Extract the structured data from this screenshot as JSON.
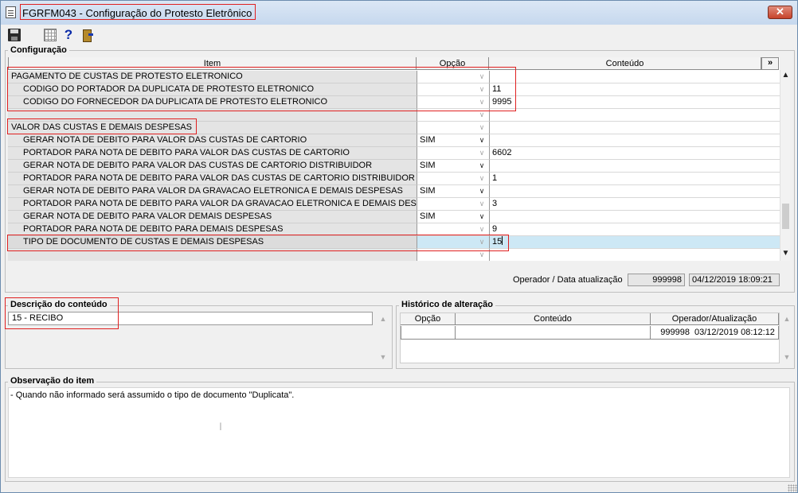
{
  "window": {
    "title": "FGRFM043 - Configuração do Protesto Eletrônico",
    "close_label": "✕"
  },
  "toolbar": {
    "icons": [
      "save-icon",
      "grid-icon",
      "help-icon",
      "exit-icon"
    ],
    "help_glyph": "?"
  },
  "config": {
    "group_label": "Configuração",
    "columns": {
      "item": "Item",
      "option": "Opção",
      "content": "Conteúdo",
      "expand": "»"
    },
    "rows": [
      {
        "item": "PAGAMENTO DE CUSTAS DE PROTESTO ELETRONICO",
        "option": "",
        "content": ""
      },
      {
        "item": "CODIGO DO PORTADOR DA DUPLICATA DE PROTESTO ELETRONICO",
        "option": "",
        "content": "11"
      },
      {
        "item": "CODIGO DO FORNECEDOR DA DUPLICATA DE PROTESTO ELETRONICO",
        "option": "",
        "content": "9995"
      },
      {
        "item": "",
        "option": "",
        "content": ""
      },
      {
        "item": "VALOR DAS CUSTAS E DEMAIS DESPESAS",
        "option": "",
        "content": ""
      },
      {
        "item": "GERAR NOTA DE DEBITO PARA VALOR DAS CUSTAS DE CARTORIO",
        "option": "SIM",
        "content": ""
      },
      {
        "item": "PORTADOR PARA NOTA DE DEBITO PARA VALOR DAS CUSTAS DE CARTORIO",
        "option": "",
        "content": "6602"
      },
      {
        "item": "GERAR NOTA DE DEBITO PARA VALOR DAS CUSTAS DE CARTORIO DISTRIBUIDOR",
        "option": "SIM",
        "content": ""
      },
      {
        "item": "PORTADOR PARA NOTA DE DEBITO PARA VALOR DAS CUSTAS DE CARTORIO DISTRIBUIDOR",
        "option": "",
        "content": "1"
      },
      {
        "item": "GERAR NOTA DE DEBITO PARA VALOR DA GRAVACAO ELETRONICA E DEMAIS DESPESAS",
        "option": "SIM",
        "content": ""
      },
      {
        "item": "PORTADOR PARA NOTA DE DEBITO PARA VALOR DA GRAVACAO ELETRONICA E DEMAIS DESPESAS",
        "option": "",
        "content": "3"
      },
      {
        "item": "GERAR NOTA DE DEBITO PARA VALOR DEMAIS DESPESAS",
        "option": "SIM",
        "content": ""
      },
      {
        "item": "PORTADOR PARA NOTA DE DEBITO PARA DEMAIS DESPESAS",
        "option": "",
        "content": "9"
      },
      {
        "item": "TIPO DE DOCUMENTO DE CUSTAS E DEMAIS DESPESAS",
        "option": "",
        "content": "15"
      },
      {
        "item": "",
        "option": "",
        "content": ""
      }
    ],
    "selected_row_index": 13,
    "operator_label": "Operador / Data atualização",
    "operator": "999998",
    "updated_at": "04/12/2019 18:09:21"
  },
  "description": {
    "group_label": "Descrição do conteúdo",
    "value": "15 - RECIBO"
  },
  "history": {
    "group_label": "Histórico de alteração",
    "columns": {
      "option": "Opção",
      "content": "Conteúdo",
      "operator": "Operador/Atualização"
    },
    "rows": [
      {
        "option": "",
        "content": "",
        "operator": "999998",
        "updated": "03/12/2019 08:12:12"
      }
    ]
  },
  "observation": {
    "group_label": "Observação do item",
    "text": "- Quando não informado será assumido o tipo de documento \"Duplicata\"."
  },
  "colors": {
    "highlight_box": "#e02020",
    "selected_row": "#cde8f5",
    "item_cell_bg": "#e4e4e4"
  }
}
